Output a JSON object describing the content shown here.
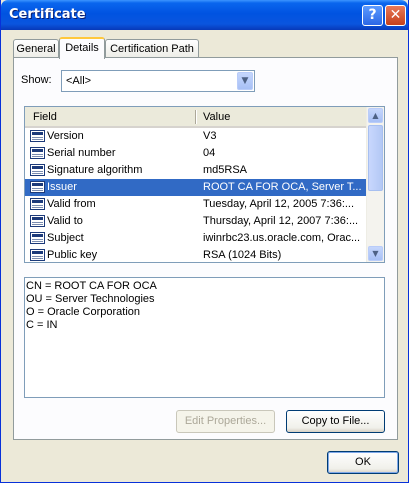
{
  "window": {
    "title": "Certificate"
  },
  "titlebar": {
    "help_glyph": "?",
    "close_glyph": "✕"
  },
  "tabs": [
    {
      "label": "General",
      "active": false
    },
    {
      "label": "Details",
      "active": true
    },
    {
      "label": "Certification Path",
      "active": false
    }
  ],
  "show": {
    "label": "Show:",
    "value": "<All>",
    "arrow_glyph": "▼"
  },
  "list": {
    "columns": [
      "Field",
      "Value"
    ],
    "rows": [
      {
        "field": "Version",
        "value": "V3",
        "selected": false
      },
      {
        "field": "Serial number",
        "value": "04",
        "selected": false
      },
      {
        "field": "Signature algorithm",
        "value": "md5RSA",
        "selected": false
      },
      {
        "field": "Issuer",
        "value": "ROOT CA FOR OCA, Server T...",
        "selected": true
      },
      {
        "field": "Valid from",
        "value": "Tuesday, April 12, 2005 7:36:...",
        "selected": false
      },
      {
        "field": "Valid to",
        "value": "Thursday, April 12, 2007 7:36:...",
        "selected": false
      },
      {
        "field": "Subject",
        "value": "iwinrbc23.us.oracle.com, Orac...",
        "selected": false
      },
      {
        "field": "Public key",
        "value": "RSA (1024 Bits)",
        "selected": false
      }
    ],
    "scroll_up_glyph": "▲",
    "scroll_down_glyph": "▼"
  },
  "details": {
    "lines": [
      "CN = ROOT CA FOR OCA",
      "OU = Server Technologies",
      "O = Oracle Corporation",
      "C = IN"
    ]
  },
  "buttons": {
    "edit_properties": "Edit Properties...",
    "copy_to_file": "Copy to File...",
    "ok": "OK"
  },
  "colors": {
    "selection": "#316ac5",
    "titlebar": "#0053e1",
    "dialog_background": "#ece9d8"
  }
}
